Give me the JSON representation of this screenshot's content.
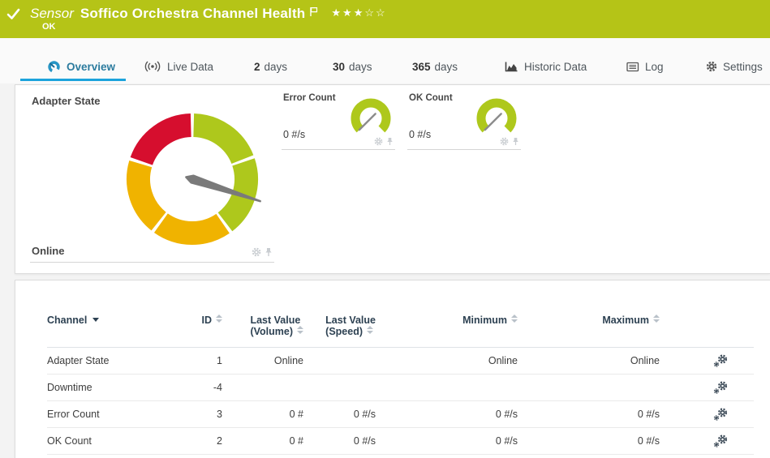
{
  "banner": {
    "kind_label": "Sensor",
    "title": "Soffico Orchestra Channel Health",
    "status": "OK",
    "stars_filled": 3,
    "stars_total": 5
  },
  "colors": {
    "banner_green": "#b5c417",
    "gauge_green": "#aec81c",
    "gauge_yellow": "#f0b300",
    "gauge_red": "#d60e2e",
    "accent_blue": "#1ca3dc",
    "needle_gray": "#7a7a7a"
  },
  "tabs": [
    {
      "label": "Overview",
      "active": true
    },
    {
      "label": "Live Data"
    },
    {
      "num": "2",
      "unit": "days"
    },
    {
      "num": "30",
      "unit": "days"
    },
    {
      "num": "365",
      "unit": "days"
    },
    {
      "label": "Historic Data"
    },
    {
      "label": "Log"
    },
    {
      "label": "Settings"
    }
  ],
  "overview": {
    "adapter": {
      "title": "Adapter State",
      "status": "Online",
      "gauge": {
        "needle_angle": 108,
        "needle_length": 88,
        "segments": [
          {
            "from": 1.5,
            "to": 68.5,
            "color": "#aec81c"
          },
          {
            "from": 71.5,
            "to": 142.5,
            "color": "#aec81c"
          },
          {
            "from": 145.5,
            "to": 215.5,
            "color": "#f0b300"
          },
          {
            "from": 218.5,
            "to": 286.5,
            "color": "#f0b300"
          },
          {
            "from": 289.5,
            "to": 358.5,
            "color": "#d60e2e"
          }
        ]
      }
    },
    "minis": [
      {
        "title": "Error Count",
        "value": "0 #/s",
        "needle_angle": 225
      },
      {
        "title": "OK Count",
        "value": "0 #/s",
        "needle_angle": 225
      }
    ]
  },
  "table": {
    "columns": [
      {
        "label": "Channel",
        "sorted": "desc"
      },
      {
        "label": "ID"
      },
      {
        "line1": "Last Value",
        "line2": "(Volume)"
      },
      {
        "line1": "Last Value",
        "line2": "(Speed)"
      },
      {
        "label": "Minimum"
      },
      {
        "label": "Maximum"
      }
    ],
    "rows": [
      {
        "channel": "Adapter State",
        "id": "1",
        "last_value_volume": "Online",
        "last_value_speed": "",
        "minimum": "Online",
        "maximum": "Online"
      },
      {
        "channel": "Downtime",
        "id": "-4",
        "last_value_volume": "",
        "last_value_speed": "",
        "minimum": "",
        "maximum": ""
      },
      {
        "channel": "Error Count",
        "id": "3",
        "last_value_volume": "0 #",
        "last_value_speed": "0 #/s",
        "minimum": "0 #/s",
        "maximum": "0 #/s"
      },
      {
        "channel": "OK Count",
        "id": "2",
        "last_value_volume": "0 #",
        "last_value_speed": "0 #/s",
        "minimum": "0 #/s",
        "maximum": "0 #/s"
      }
    ]
  }
}
